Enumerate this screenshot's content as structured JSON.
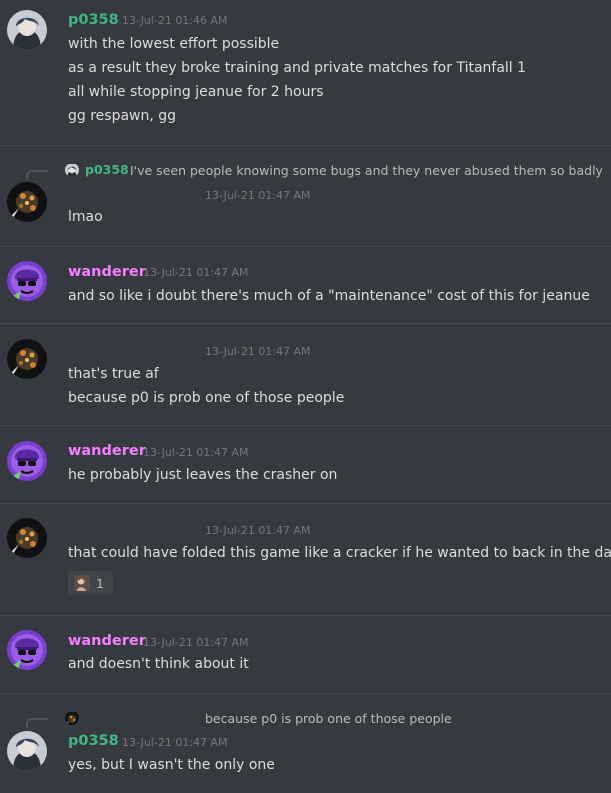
{
  "colors": {
    "background": "#36393f",
    "divider": "#42454b",
    "username_p0358": "#43b581",
    "username_wanderer": "#f47fff",
    "text": "#dcddde",
    "timestamp": "#72767d"
  },
  "messages": [
    {
      "username": "p0358",
      "timestamp": "13-Jul-21 01:46 AM",
      "lines": [
        "with the lowest effort possible",
        "as a result they broke training and private matches for Titanfall 1",
        "all while stopping jeanue for 2 hours",
        "gg respawn, gg"
      ]
    },
    {
      "reply": {
        "username": "p0358",
        "text": "I've seen people knowing some bugs and they never abused them so badly"
      },
      "timestamp": "13-Jul-21 01:47 AM",
      "lines": [
        "lmao"
      ]
    },
    {
      "username": "wanderer",
      "timestamp": "13-Jul-21 01:47 AM",
      "lines": [
        "and so like i doubt there's much of a \"maintenance\" cost of this for jeanue"
      ]
    },
    {
      "timestamp": "13-Jul-21 01:47 AM",
      "lines": [
        "that's true af",
        "because p0 is prob one of those people"
      ]
    },
    {
      "username": "wanderer",
      "timestamp": "13-Jul-21 01:47 AM",
      "lines": [
        "he probably just leaves the crasher on"
      ]
    },
    {
      "timestamp": "13-Jul-21 01:47 AM",
      "lines": [
        "that could have folded this game like a cracker if he wanted to back in the day"
      ],
      "reaction_count": "1"
    },
    {
      "username": "wanderer",
      "timestamp": "13-Jul-21 01:47 AM",
      "lines": [
        "and doesn't think about it"
      ]
    },
    {
      "reply": {
        "text": "because p0 is prob one of those people"
      },
      "username": "p0358",
      "timestamp": "13-Jul-21 01:47 AM",
      "lines": [
        "yes, but I wasn't the only one"
      ]
    }
  ]
}
